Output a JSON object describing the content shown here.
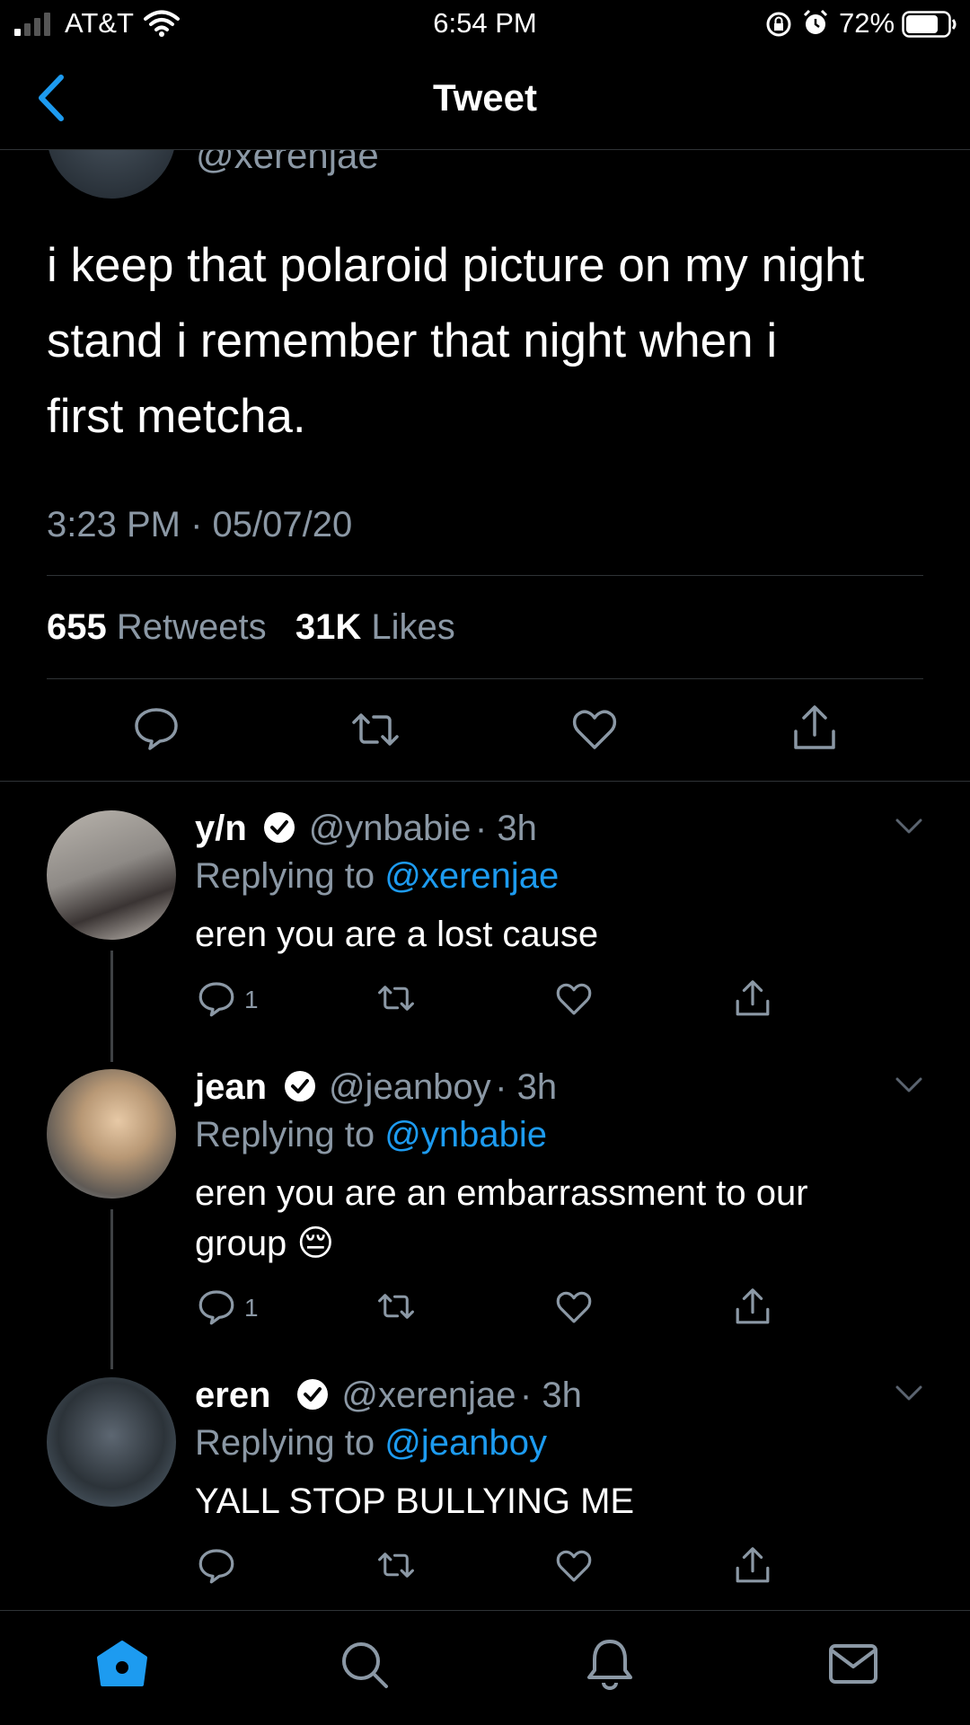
{
  "status": {
    "carrier": "AT&T",
    "time": "6:54 PM",
    "battery": "72%"
  },
  "nav": {
    "title": "Tweet"
  },
  "tweet": {
    "handle": "@xerenjae",
    "line1": "i keep that polaroid picture on my night",
    "line2": "stand i remember that night when i",
    "line3": "first metcha.",
    "timestamp": "3:23 PM · 05/07/20",
    "retweets": "655",
    "retweets_label": "Retweets",
    "likes": "31K",
    "likes_label": "Likes"
  },
  "replies": [
    {
      "name": "y/n",
      "handle": "@ynbabie",
      "time": "· 3h",
      "replying_label": "Replying to",
      "replying_to": "@xerenjae",
      "text": "eren you are a lost cause",
      "reply_count": "1"
    },
    {
      "name": "jean",
      "handle": "@jeanboy",
      "time": "· 3h",
      "replying_label": "Replying to",
      "replying_to": "@ynbabie",
      "text_line1": "eren you are an embarrassment to our",
      "text_line2": "group",
      "emoji": "😔",
      "reply_count": "1"
    },
    {
      "name": "eren",
      "handle": "@xerenjae",
      "time": "· 3h",
      "replying_label": "Replying to",
      "replying_to": "@jeanboy",
      "text": "YALL STOP BULLYING ME"
    }
  ],
  "tabbar": {
    "items": [
      "home-icon",
      "search-icon",
      "bell-icon",
      "mail-icon"
    ]
  },
  "colors": {
    "accent": "#1d9bf0",
    "muted": "#8b98a5",
    "background": "#000000"
  }
}
